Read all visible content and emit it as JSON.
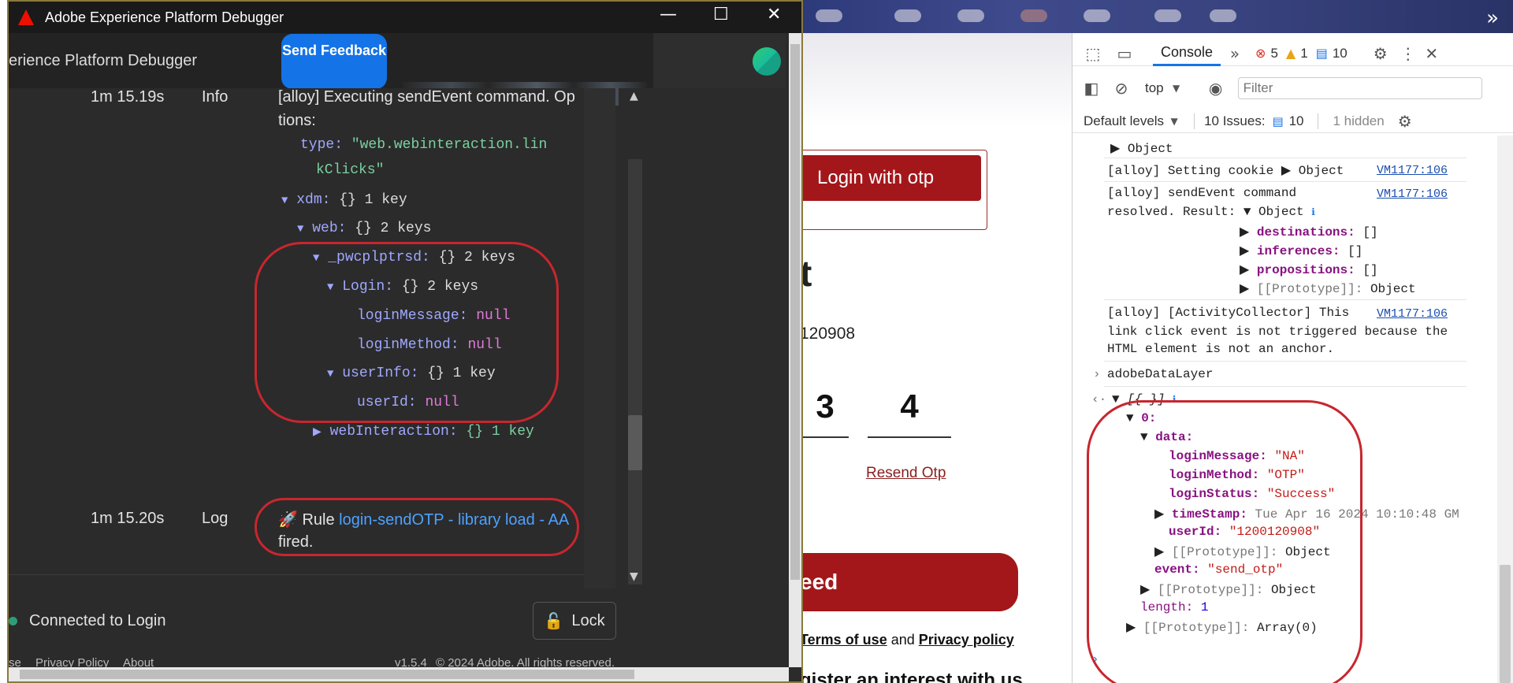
{
  "colors": {
    "accent": "#1473e6",
    "brand_red": "#a3171b",
    "annotation_red": "#c8262e"
  },
  "debugger": {
    "window_title": "Adobe Experience Platform Debugger",
    "header_title": "erience Platform Debugger",
    "send_feedback": "Send Feedback",
    "log_rows": [
      {
        "time": "1m 15.19s",
        "level": "Info",
        "message_line1": "[alloy] Executing sendEvent command. Op",
        "message_line2": "tions:",
        "code": {
          "type_key": "type:",
          "type_val_1": "\"web.webinteraction.lin",
          "type_val_2": "kClicks\"",
          "xdm": "xdm:",
          "xdm_info": "{}  1 key",
          "web": "web:",
          "web_info": "{}  2 keys",
          "pwc": "_pwcplptrsd:",
          "pwc_info": "{}  2 keys",
          "login": "Login:",
          "login_info": "{}  2 keys",
          "loginMessage": "loginMessage:",
          "loginMethod": "loginMethod:",
          "userInfo": "userInfo:",
          "userInfo_info": "{}  1 key",
          "userId": "userId:",
          "null": "null",
          "webInteraction": "webInteraction:",
          "webInteraction_info": "{}  1 key"
        }
      },
      {
        "time": "1m 15.20s",
        "level": "Log",
        "rule_prefix": "Rule",
        "rule_name": "login-sendOTP - library load - AA",
        "rule_suffix": "fired."
      }
    ],
    "connected": "Connected to Login",
    "lock": "Lock",
    "footer": {
      "use": "se",
      "privacy": "Privacy Policy",
      "about": "About",
      "version": "v1.5.4",
      "copyright": "© 2024 Adobe. All rights reserved."
    }
  },
  "webpage": {
    "login_otp": "Login with otp",
    "big_t": "t",
    "phone": "120908",
    "otp_digits": [
      "3",
      "4"
    ],
    "resend": "Resend Otp",
    "proceed": "eed",
    "terms_prefix": "",
    "terms": "Terms of use",
    "and": " and ",
    "privacy": "Privacy policy",
    "register": "gister an interest with us"
  },
  "devtools": {
    "console_tab": "Console",
    "errors": "5",
    "warnings": "1",
    "messages": "10",
    "context": "top",
    "filter_placeholder": "Filter",
    "levels": "Default levels",
    "issues_label": "10 Issues:",
    "issues_count": "10",
    "hidden": "1 hidden",
    "lines": {
      "obj": "Object",
      "cookie": "[alloy] Setting cookie",
      "vm": "VM1177:106",
      "resolved_1": "[alloy] sendEvent command",
      "resolved_2": "resolved. Result:",
      "destinations": "destinations:",
      "inferences": "inferences:",
      "propositions": "propositions:",
      "empty_arr": "[]",
      "prototype": "[[Prototype]]:",
      "activity_1": "[alloy] [ActivityCollector] This",
      "activity_2": "link click event is not triggered because the",
      "activity_3": "HTML element is not an anchor.",
      "adl": "adobeDataLayer",
      "arr": "[{…}]",
      "idx0": "0:",
      "data": "data:",
      "loginMessage": "loginMessage:",
      "loginMessage_val": "\"NA\"",
      "loginMethod": "loginMethod:",
      "loginMethod_val": "\"OTP\"",
      "loginStatus": "loginStatus:",
      "loginStatus_val": "\"Success\"",
      "timeStamp": "timeStamp:",
      "timeStamp_val": "Tue Apr 16 2024 10:10:48 GM",
      "userId": "userId:",
      "userId_val": "\"1200120908\"",
      "event": "event:",
      "event_val": "\"send_otp\"",
      "length": "length:",
      "length_val": "1",
      "array0": "Array(0)"
    }
  }
}
